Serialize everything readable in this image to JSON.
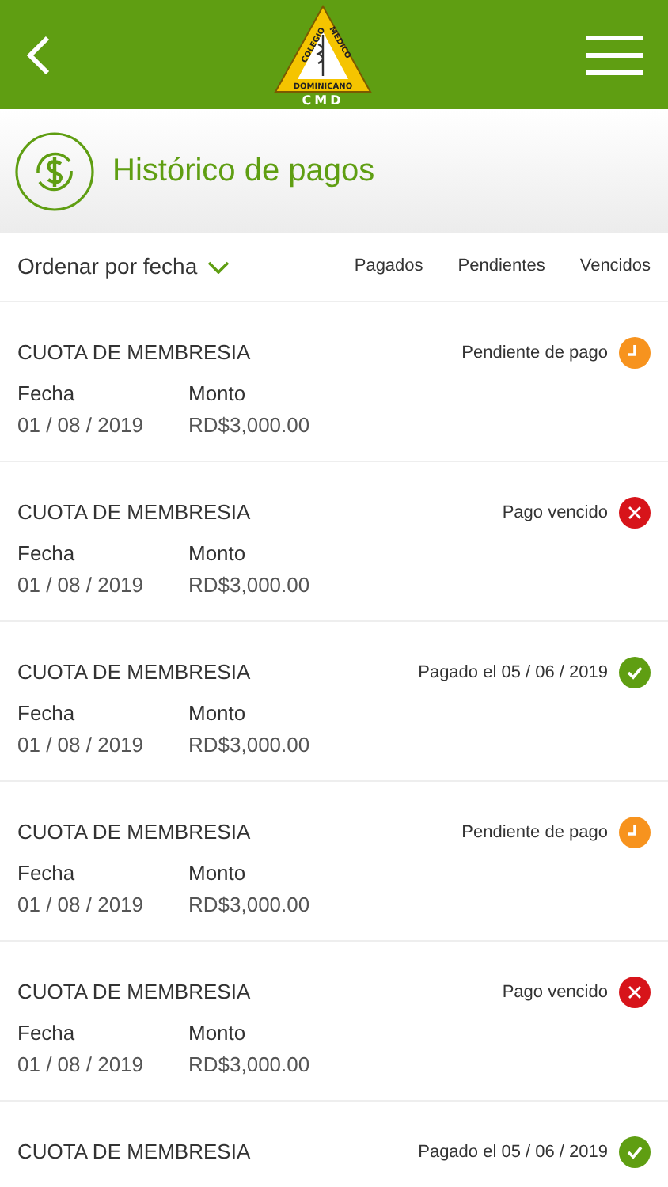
{
  "header": {
    "logo": {
      "arc_left": "COLEGIO",
      "arc_right": "MEDICO",
      "base": "DOMINICANO",
      "acronym": "CMD"
    }
  },
  "page_title": "Histórico de pagos",
  "filters": {
    "sort": "Ordenar por fecha",
    "tabs": [
      {
        "label": "Pagados",
        "selected": false
      },
      {
        "label": "Pendientes",
        "selected": false
      },
      {
        "label": "Vencidos",
        "selected": false
      }
    ]
  },
  "payments": [
    {
      "title": "CUOTA DE MEMBRESIA",
      "status": "Pendiente de pago",
      "kind": "pending",
      "fields": [
        {
          "label": "Fecha",
          "value": "01 / 08 / 2019"
        },
        {
          "label": "Monto",
          "value": "RD$3,000.00"
        }
      ]
    },
    {
      "title": "CUOTA DE MEMBRESIA",
      "status": "Pago vencido",
      "kind": "overdue",
      "fields": [
        {
          "label": "Fecha",
          "value": "01 / 08 / 2019"
        },
        {
          "label": "Monto",
          "value": "RD$3,000.00"
        }
      ]
    },
    {
      "title": "CUOTA DE MEMBRESIA",
      "status": "Pagado el 05 / 06 / 2019",
      "kind": "paid",
      "fields": [
        {
          "label": "Fecha",
          "value": "01 / 08 / 2019"
        },
        {
          "label": "Monto",
          "value": "RD$3,000.00"
        }
      ]
    },
    {
      "title": "CUOTA DE MEMBRESIA",
      "status": "Pendiente de pago",
      "kind": "pending",
      "fields": [
        {
          "label": "Fecha",
          "value": "01 / 08 / 2019"
        },
        {
          "label": "Monto",
          "value": "RD$3,000.00"
        }
      ]
    },
    {
      "title": "CUOTA DE MEMBRESIA",
      "status": "Pago vencido",
      "kind": "overdue",
      "fields": [
        {
          "label": "Fecha",
          "value": "01 / 08 / 2019"
        },
        {
          "label": "Monto",
          "value": "RD$3,000.00"
        }
      ]
    },
    {
      "title": "CUOTA DE MEMBRESIA",
      "status": "Pagado el 05 / 06 / 2019",
      "kind": "paid"
    }
  ]
}
